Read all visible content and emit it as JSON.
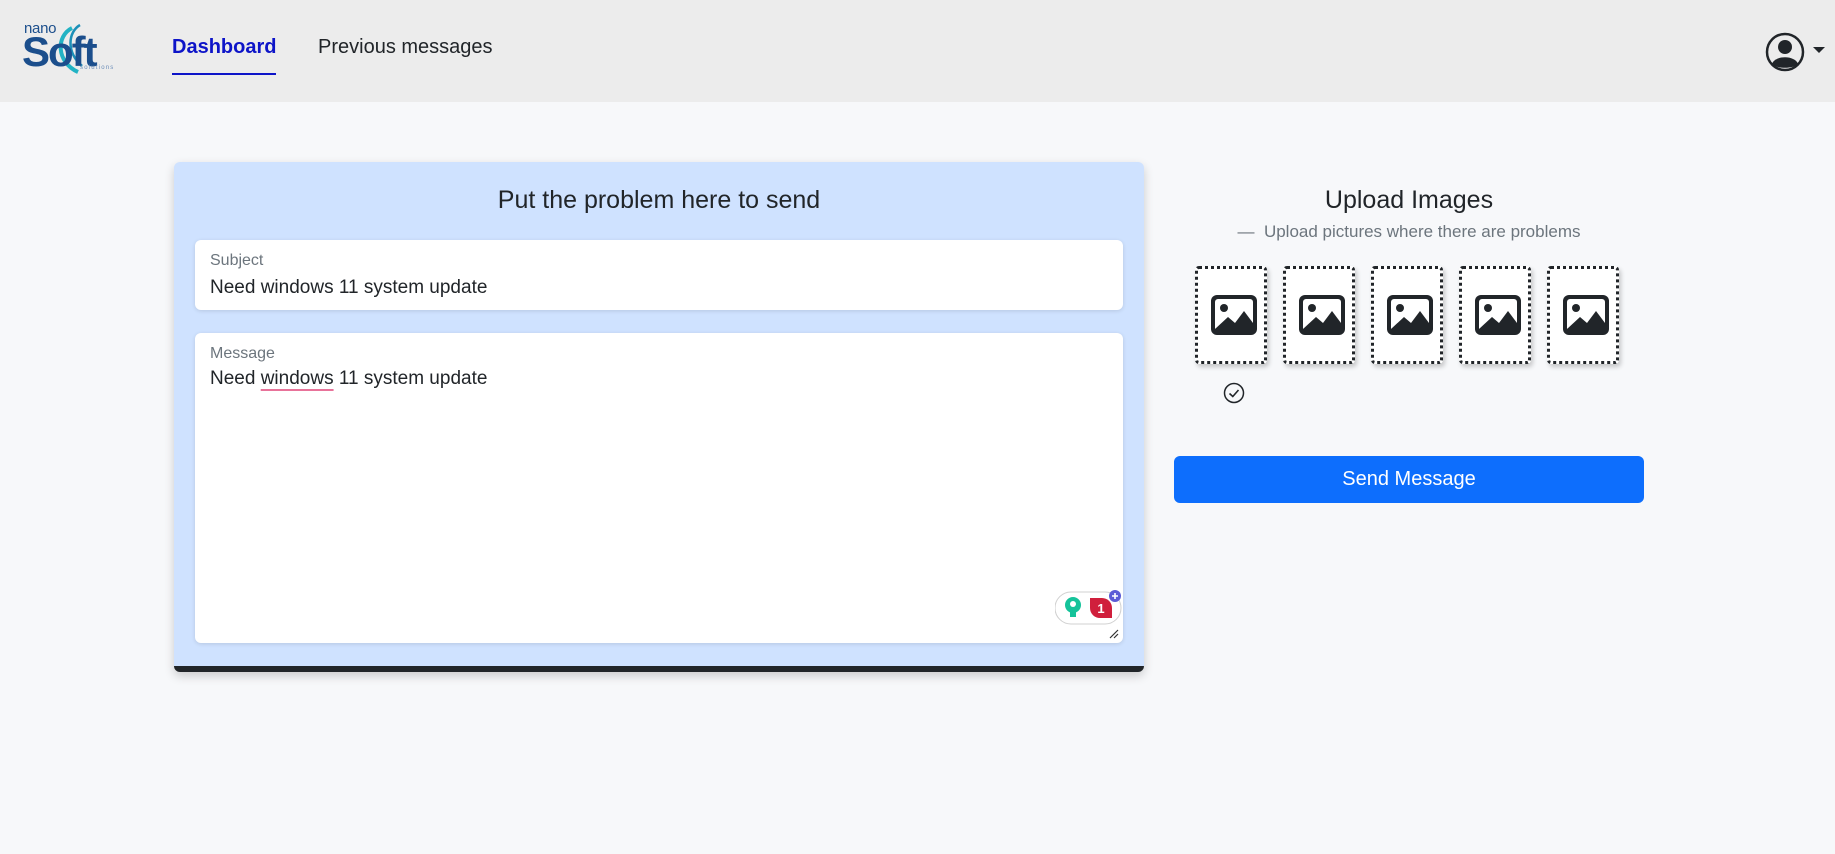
{
  "header": {
    "logo": {
      "top": "nano",
      "main": "Soft",
      "bottom": "solutions"
    },
    "nav": [
      {
        "label": "Dashboard",
        "active": true
      },
      {
        "label": "Previous messages",
        "active": false
      }
    ],
    "user_icon": "user-circle-icon"
  },
  "form": {
    "title": "Put the problem here to send",
    "subject": {
      "label": "Subject",
      "value": "Need windows 11 system update"
    },
    "message": {
      "label": "Message",
      "value_before": "Need ",
      "value_flagged": "windows",
      "value_after": " 11 system update"
    },
    "grammarly_badge_count": "1"
  },
  "upload": {
    "title": "Upload Images",
    "subtitle_dash": "—",
    "subtitle": "Upload pictures where there are problems",
    "slots": [
      {
        "icon": "image-icon",
        "checked": true
      },
      {
        "icon": "image-icon",
        "checked": false
      },
      {
        "icon": "image-icon",
        "checked": false
      },
      {
        "icon": "image-icon",
        "checked": false
      },
      {
        "icon": "image-icon",
        "checked": false
      }
    ]
  },
  "send_button": {
    "label": "Send Message"
  },
  "colors": {
    "nav_active": "#0d14c8",
    "card_bg": "#cfe2ff",
    "primary": "#0d6efd",
    "header_bg": "#ececec"
  }
}
